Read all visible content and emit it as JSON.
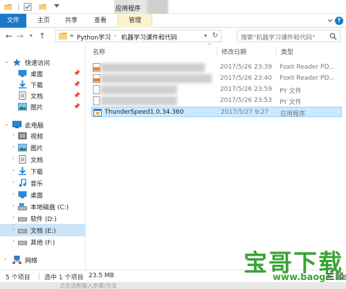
{
  "titlebar": {
    "context_tab": "应用程序"
  },
  "ribbon": {
    "tabs": [
      "文件",
      "主页",
      "共享",
      "查看",
      "管理"
    ]
  },
  "address": {
    "prefix": "«",
    "crumbs": [
      "Python学习",
      "机器学习课件和代码"
    ],
    "separator": "›",
    "search_placeholder": "搜索\"机器学习课件和代码\""
  },
  "sidebar": {
    "quick_access": "快速访问",
    "quick_items": [
      "桌面",
      "下载",
      "文档",
      "图片"
    ],
    "this_pc": "此电脑",
    "pc_items": [
      "视频",
      "图片",
      "文档",
      "下载",
      "音乐",
      "桌面",
      "本地磁盘 (C:)",
      "软件 (D:)",
      "文档 (E:)",
      "其他 (F:)"
    ],
    "network": "网络"
  },
  "columns": {
    "name": "名称",
    "date": "修改日期",
    "type": "类型"
  },
  "files": [
    {
      "name": "",
      "date": "2017/5/26 23:39",
      "type": "Foxit Reader PD...",
      "icon": "pdf-icon"
    },
    {
      "name": "",
      "date": "2017/5/26 23:40",
      "type": "Foxit Reader PD...",
      "icon": "pdf-icon"
    },
    {
      "name": "",
      "date": "2017/5/26 23:59",
      "type": "PY 文件",
      "icon": "py-file-icon"
    },
    {
      "name": "",
      "date": "2017/5/26 23:53",
      "type": "PY 文件",
      "icon": "py-file-icon"
    },
    {
      "name": "ThunderSpeed1.0.34.360",
      "date": "2017/5/27 9:27",
      "type": "应用程序",
      "icon": "exe-icon"
    }
  ],
  "status": {
    "count": "5 个项目",
    "selection": "选中 1 个项目",
    "size": "23.5 MB"
  },
  "bottom_caption": "点击选框输入步骤/方法",
  "watermark": {
    "title": "宝哥下载",
    "url": "www.baoge.net"
  },
  "colors": {
    "accent": "#1979ca",
    "selection": "#cce8ff",
    "watermark": "#3aa335"
  }
}
